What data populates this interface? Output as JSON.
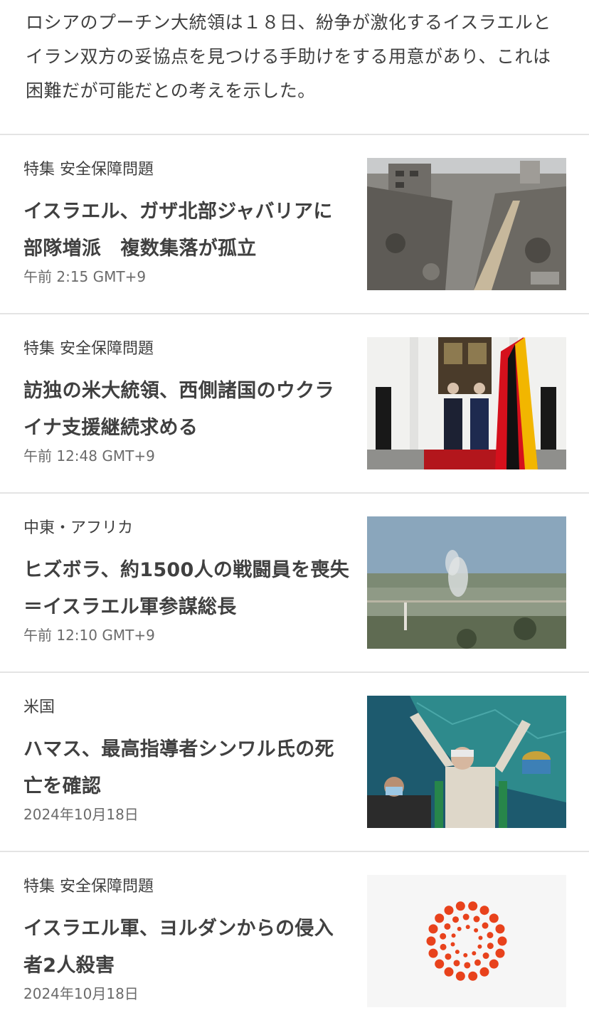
{
  "lead_paragraph": "ロシアのプーチン大統領は１８日、紛争が激化するイスラエルとイラン双方の妥協点を見つける手助けをする用意があり、これは困難だが可能だとの考えを示した。",
  "articles": [
    {
      "category": "特集 安全保障問題",
      "headline": "イスラエル、ガザ北部ジャバリアに部隊増派　複数集落が孤立",
      "time": "午前 2:15 GMT+9",
      "image": "rubble-street-photo"
    },
    {
      "category": "特集 安全保障問題",
      "headline": "訪独の米大統領、西側諸国のウクライナ支援継続求める",
      "time": "午前 12:48 GMT+9",
      "image": "state-visit-honor-guard-photo"
    },
    {
      "category": "中東・アフリカ",
      "headline": "ヒズボラ、約1500人の戦闘員を喪失＝イスラエル軍参謀総長",
      "time": "午前 12:10 GMT+9",
      "image": "landscape-smoke-photo"
    },
    {
      "category": "米国",
      "headline": "ハマス、最高指導者シンワル氏の死亡を確認",
      "time": "2024年10月18日",
      "image": "leader-victory-sign-photo"
    },
    {
      "category": "特集 安全保障問題",
      "headline": "イスラエル軍、ヨルダンからの侵入者2人殺害",
      "time": "2024年10月18日",
      "image": "reuters-logo-placeholder"
    }
  ],
  "colors": {
    "text": "#404040",
    "meta": "#6b6b6b",
    "divider": "#e4e4e4",
    "logo": "#e8421c"
  }
}
